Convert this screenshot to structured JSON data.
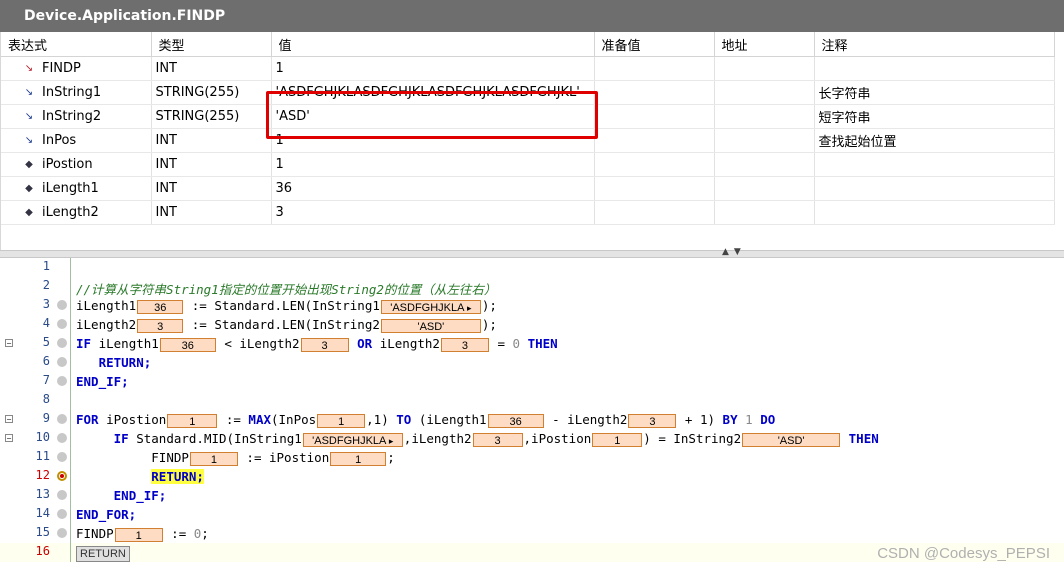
{
  "window": {
    "title": "Device.Application.FINDP"
  },
  "table": {
    "headers": [
      "表达式",
      "类型",
      "值",
      "准备值",
      "地址",
      "注释"
    ],
    "rows": [
      {
        "name": "FINDP",
        "icon": "output-var-icon",
        "type": "INT",
        "value": "1",
        "prepared": "",
        "address": "",
        "comment": ""
      },
      {
        "name": "InString1",
        "icon": "input-var-icon",
        "type": "STRING(255)",
        "value": "'ASDFGHJKLASDFGHJKLASDFGHJKLASDFGHJKL'",
        "prepared": "",
        "address": "",
        "comment": "长字符串"
      },
      {
        "name": "InString2",
        "icon": "input-var-icon",
        "type": "STRING(255)",
        "value": "'ASD'",
        "prepared": "",
        "address": "",
        "comment": "短字符串"
      },
      {
        "name": "InPos",
        "icon": "input-var-icon",
        "type": "INT",
        "value": "1",
        "prepared": "",
        "address": "",
        "comment": "查找起始位置"
      },
      {
        "name": "iPostion",
        "icon": "local-var-icon",
        "type": "INT",
        "value": "1",
        "prepared": "",
        "address": "",
        "comment": ""
      },
      {
        "name": "iLength1",
        "icon": "local-var-icon",
        "type": "INT",
        "value": "36",
        "prepared": "",
        "address": "",
        "comment": ""
      },
      {
        "name": "iLength2",
        "icon": "local-var-icon",
        "type": "INT",
        "value": "3",
        "prepared": "",
        "address": "",
        "comment": ""
      }
    ]
  },
  "code": {
    "line_numbers": [
      "1",
      "2",
      "3",
      "4",
      "5",
      "6",
      "7",
      "8",
      "9",
      "10",
      "11",
      "12",
      "13",
      "14",
      "15",
      "16"
    ],
    "comment": "//计算从字符串String1指定的位置开始出现String2的位置（从左往右）",
    "l3": {
      "v1": "iLength1",
      "m1": "36",
      "op": " := Standard.LEN(InString1",
      "m2": "'ASDFGHJKLA",
      "end": ");"
    },
    "l4": {
      "v1": "iLength2",
      "m1": "3",
      "op": " := Standard.LEN(InString2",
      "m2": "'ASD'",
      "end": ");"
    },
    "l5": {
      "kw_if": "IF",
      "v1": " iLength1",
      "m1": "36",
      "op": " < iLength2",
      "m2": "3",
      "kw_or": "OR",
      "v2": " iLength2",
      "m3": "3",
      "eq": " = ",
      "zero": "0",
      "kw_then": "THEN"
    },
    "l6": {
      "kw": "RETURN;"
    },
    "l7": {
      "kw": "END_IF;"
    },
    "l9": {
      "kw_for": "FOR",
      "v1": " iPostion",
      "m1": "1",
      "op": " := ",
      "kw_max": "MAX",
      "t1": "(InPos",
      "m2": "1",
      "t2": ",1) ",
      "kw_to": "TO",
      "t3": " (iLength1",
      "m3": "36",
      "t4": " - iLength2",
      "m4": "3",
      "t5": " + 1) ",
      "kw_by": "BY",
      "one": " 1 ",
      "kw_do": "DO"
    },
    "l10": {
      "kw_if": "IF",
      "t1": " Standard.MID(InString1",
      "m1": "'ASDFGHJKLA",
      "t2": ",iLength2",
      "m2": "3",
      "t3": ",iPostion",
      "m3": "1",
      "t4": ") = InString2",
      "m4": "'ASD'",
      "kw_then": "THEN"
    },
    "l11": {
      "v1": "FINDP",
      "m1": "1",
      "op": " := iPostion",
      "m2": "1",
      "end": ";"
    },
    "l12": {
      "kw": "RETURN;"
    },
    "l13": {
      "kw": "END_IF;"
    },
    "l14": {
      "kw": "END_FOR;"
    },
    "l15": {
      "v1": "FINDP",
      "m1": "1",
      "op": " := ",
      "zero": "0",
      "end": ";"
    },
    "l16": {
      "ret": "RETURN"
    }
  },
  "watermark": "CSDN @Codesys_PEPSI"
}
